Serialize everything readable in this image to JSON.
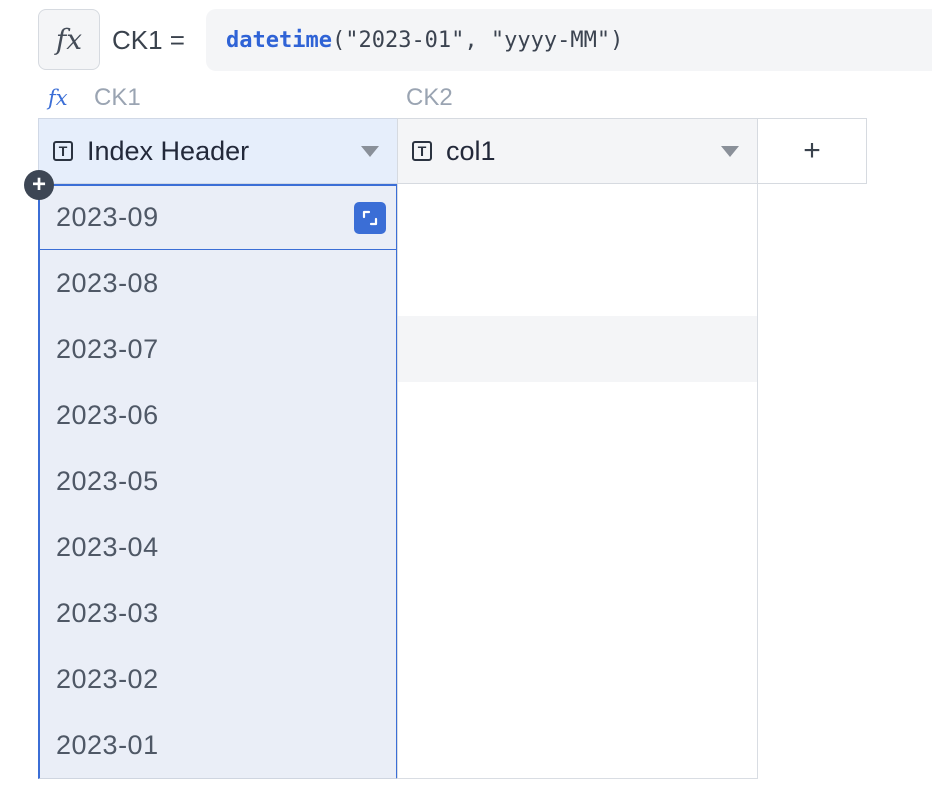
{
  "formula_bar": {
    "fx_symbol": "fx",
    "target_label": "CK1 =",
    "function_name": "datetime",
    "function_args": "(\"2023-01\", \"yyyy-MM\")"
  },
  "column_keys": {
    "ck1_fx": "fx",
    "ck1": "CK1",
    "ck2": "CK2"
  },
  "columns": [
    {
      "type_icon": "T",
      "label": "Index Header"
    },
    {
      "type_icon": "T",
      "label": "col1"
    }
  ],
  "add_column_label": "+",
  "add_row_label": "+",
  "rows": [
    {
      "value": "2023-09"
    },
    {
      "value": "2023-08"
    },
    {
      "value": "2023-07"
    },
    {
      "value": "2023-06"
    },
    {
      "value": "2023-05"
    },
    {
      "value": "2023-04"
    },
    {
      "value": "2023-03"
    },
    {
      "value": "2023-02"
    },
    {
      "value": "2023-01"
    }
  ],
  "colors": {
    "accent": "#3b6ed6",
    "selected_column_bg": "#eaeef7"
  }
}
